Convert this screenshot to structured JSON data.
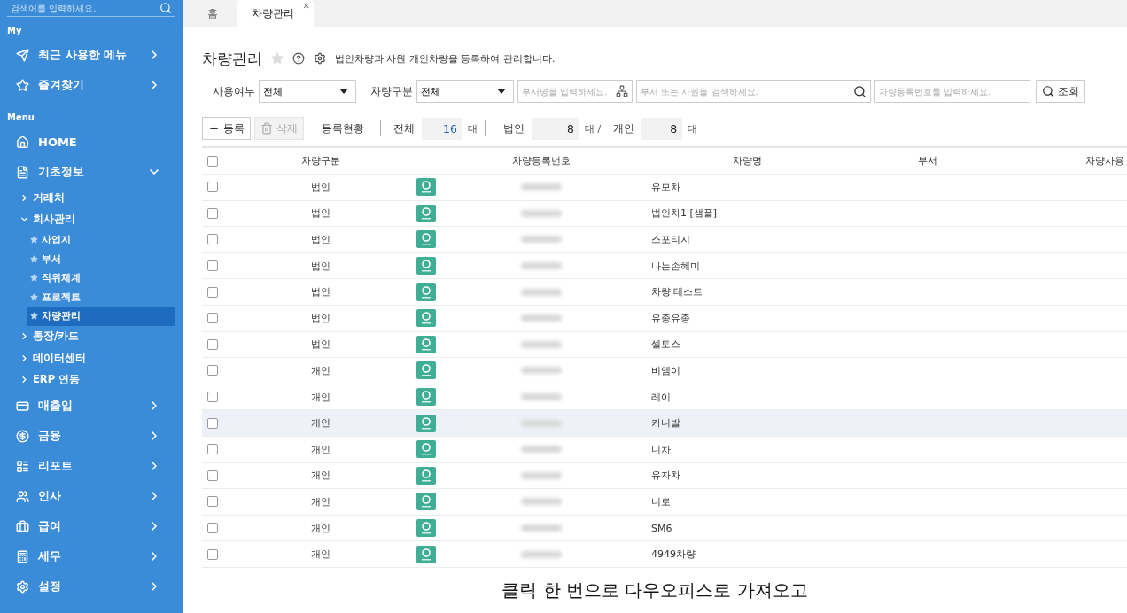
{
  "sidebar": {
    "search": {
      "placeholder": "검색어를 입력하세요."
    },
    "sections": [
      {
        "title": "My",
        "items": [
          {
            "label": "최근 사용한 메뉴",
            "expanded": false
          },
          {
            "label": "즐겨찾기",
            "expanded": false
          }
        ]
      },
      {
        "title": "Menu",
        "items": [
          {
            "label": "HOME"
          },
          {
            "label": "기초정보",
            "expanded": true,
            "children": [
              {
                "label": "거래처",
                "expanded": false
              },
              {
                "label": "회사관리",
                "expanded": true,
                "children": [
                  {
                    "label": "사업지",
                    "selected": false
                  },
                  {
                    "label": "부서",
                    "selected": false
                  },
                  {
                    "label": "직위체계",
                    "selected": false
                  },
                  {
                    "label": "프로젝트",
                    "selected": false
                  },
                  {
                    "label": "차량관리",
                    "selected": true
                  }
                ]
              },
              {
                "label": "통장/카드",
                "expanded": false
              },
              {
                "label": "데이터센터",
                "expanded": false
              },
              {
                "label": "ERP 연동",
                "expanded": false
              }
            ]
          },
          {
            "label": "매출입",
            "expanded": false
          },
          {
            "label": "금융",
            "expanded": false
          },
          {
            "label": "리포트",
            "expanded": false
          },
          {
            "label": "인사",
            "expanded": false
          },
          {
            "label": "급여",
            "expanded": false
          },
          {
            "label": "세무",
            "expanded": false
          },
          {
            "label": "설정",
            "expanded": false
          }
        ]
      }
    ]
  },
  "tabs": [
    {
      "label": "홈",
      "selected": false
    },
    {
      "label": "차량관리",
      "selected": true,
      "close": "✕"
    }
  ],
  "page": {
    "title": "차량관리",
    "description": "법인차량과 사원 개인차량을 등록하여 관리합니다."
  },
  "filters": {
    "usage": {
      "label": "사용여부",
      "value": "전체"
    },
    "type": {
      "label": "차량구분",
      "value": "전체"
    },
    "department": {
      "placeholder": "부서명을 입력하세요."
    },
    "person": {
      "placeholder": "부서 또는 사원을 검색하세요."
    },
    "plate": {
      "placeholder": "차량등록번호를 입력하세요."
    },
    "search_button": "조회"
  },
  "toolbar": {
    "add": {
      "label": "등록",
      "disabled": false
    },
    "delete": {
      "label": "삭제",
      "disabled": true
    },
    "status_label": "등록현황",
    "total_label": "전체",
    "total": "16",
    "unit": "대",
    "corporate_label": "법인",
    "corporate": "8",
    "corporate_unit": "대 /",
    "personal_label": "개인",
    "personal": "8",
    "personal_unit": "대"
  },
  "table": {
    "header_checked": false,
    "columns": [
      "차량구분",
      "차량등록번호",
      "차량명",
      "부서",
      "차량사용"
    ],
    "rows": [
      {
        "type": "법인",
        "name": "유모차",
        "checked": false,
        "selected": false
      },
      {
        "type": "법인",
        "name": "법인차1 [샘플]",
        "checked": false,
        "selected": false
      },
      {
        "type": "법인",
        "name": "스포티지",
        "checked": false,
        "selected": false
      },
      {
        "type": "법인",
        "name": "나는손혜미",
        "checked": false,
        "selected": false
      },
      {
        "type": "법인",
        "name": "차량 테스트",
        "checked": false,
        "selected": false
      },
      {
        "type": "법인",
        "name": "유종유종",
        "checked": false,
        "selected": false
      },
      {
        "type": "법인",
        "name": "셀토스",
        "checked": false,
        "selected": false
      },
      {
        "type": "개인",
        "name": "비엠이",
        "checked": false,
        "selected": false
      },
      {
        "type": "개인",
        "name": "레이",
        "checked": false,
        "selected": false
      },
      {
        "type": "개인",
        "name": "카니발",
        "checked": false,
        "selected": true
      },
      {
        "type": "개인",
        "name": "니차",
        "checked": false,
        "selected": false
      },
      {
        "type": "개인",
        "name": "유자차",
        "checked": false,
        "selected": false
      },
      {
        "type": "개인",
        "name": "니로",
        "checked": false,
        "selected": false
      },
      {
        "type": "개인",
        "name": "SM6",
        "checked": false,
        "selected": false
      },
      {
        "type": "개인",
        "name": "4949차량",
        "checked": false,
        "selected": false
      }
    ]
  },
  "caption": "클릭 한 번으로 다우오피스로 가져오고"
}
